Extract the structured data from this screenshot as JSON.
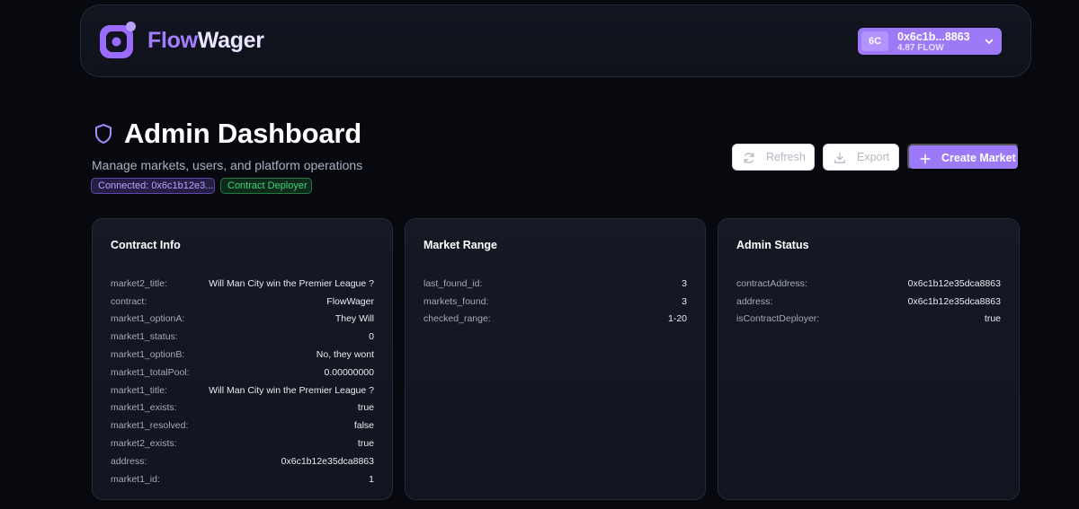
{
  "header": {
    "logo_prefix": "Flow",
    "logo_suffix": "Wager",
    "wallet": {
      "badge": "6C",
      "address": "0x6c1b...8863",
      "balance": "4.87 FLOW"
    }
  },
  "page": {
    "title": "Admin Dashboard",
    "subtitle": "Manage markets, users, and platform operations",
    "badges": {
      "connected": "Connected: 0x6c1b12e3...",
      "role": "Contract Deployer"
    }
  },
  "actions": {
    "refresh": "Refresh",
    "export": "Export",
    "create": "Create Market"
  },
  "cards": {
    "contract_info": {
      "title": "Contract Info",
      "rows": [
        {
          "key": "market2_title:",
          "value": "Will Man City win the Premier League ?"
        },
        {
          "key": "contract:",
          "value": "FlowWager"
        },
        {
          "key": "market1_optionA:",
          "value": "They Will"
        },
        {
          "key": "market1_status:",
          "value": "0"
        },
        {
          "key": "market1_optionB:",
          "value": "No, they wont"
        },
        {
          "key": "market1_totalPool:",
          "value": "0.00000000"
        },
        {
          "key": "market1_title:",
          "value": "Will Man City win the Premier League ?"
        },
        {
          "key": "market1_exists:",
          "value": "true"
        },
        {
          "key": "market1_resolved:",
          "value": "false"
        },
        {
          "key": "market2_exists:",
          "value": "true"
        },
        {
          "key": "address:",
          "value": "0x6c1b12e35dca8863"
        },
        {
          "key": "market1_id:",
          "value": "1"
        }
      ]
    },
    "market_range": {
      "title": "Market Range",
      "rows": [
        {
          "key": "last_found_id:",
          "value": "3"
        },
        {
          "key": "markets_found:",
          "value": "3"
        },
        {
          "key": "checked_range:",
          "value": "1-20"
        }
      ]
    },
    "admin_status": {
      "title": "Admin Status",
      "rows": [
        {
          "key": "contractAddress:",
          "value": "0x6c1b12e35dca8863"
        },
        {
          "key": "address:",
          "value": "0x6c1b12e35dca8863"
        },
        {
          "key": "isContractDeployer:",
          "value": "true"
        }
      ]
    }
  },
  "colors": {
    "accent": "#9b79f7",
    "background": "#07090f",
    "success": "#41d27a"
  },
  "icons": [
    "logo-icon",
    "chevron-down-icon",
    "shield-icon",
    "refresh-icon",
    "download-icon",
    "plus-icon"
  ]
}
